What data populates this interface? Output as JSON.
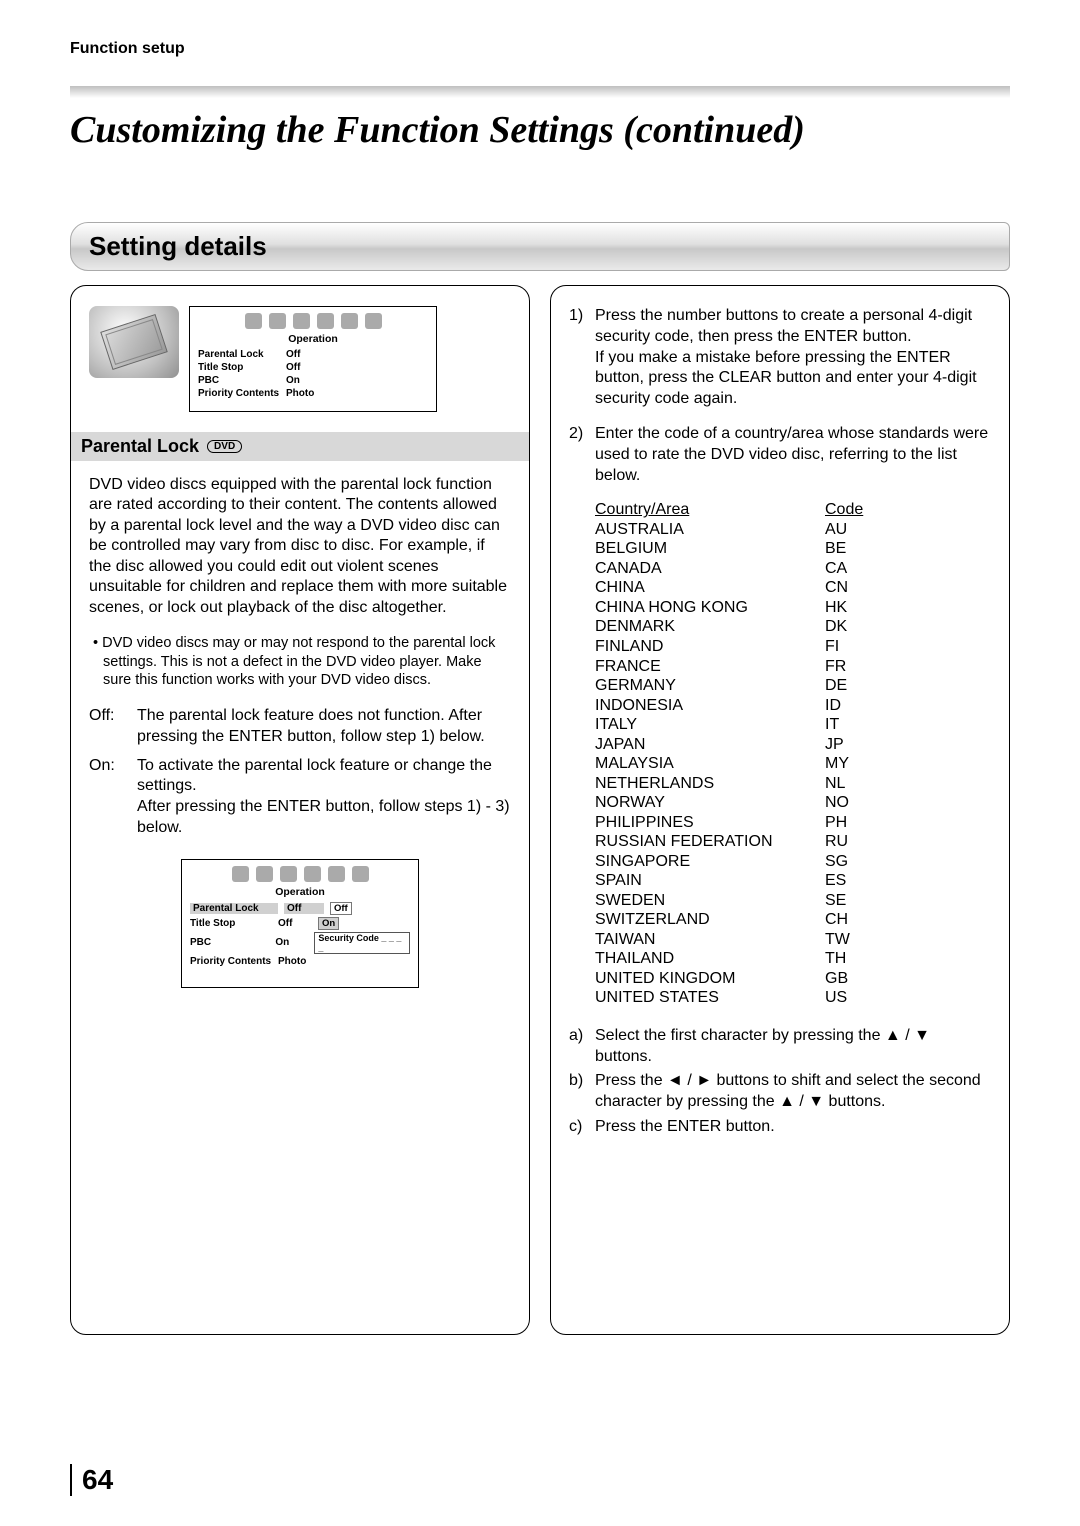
{
  "breadcrumb": "Function setup",
  "main_title": "Customizing the Function Settings (continued)",
  "section_header": "Setting details",
  "page_number": "64",
  "left": {
    "osd_title": "Operation",
    "rows": [
      {
        "label": "Parental Lock",
        "val": "Off"
      },
      {
        "label": "Title Stop",
        "val": "Off"
      },
      {
        "label": "PBC",
        "val": "On"
      },
      {
        "label": "Priority Contents",
        "val": "Photo"
      }
    ],
    "sub_header": "Parental Lock",
    "dvd_badge": "DVD",
    "intro": "DVD video discs equipped with the parental lock function are rated according to their content. The contents allowed by a parental lock level and the way a DVD video disc can be controlled may vary from disc to disc. For example, if the disc allowed you could edit out violent scenes unsuitable for children and replace them with more suitable scenes, or lock out playback of the disc altogether.",
    "bullet": "• DVD video discs may or may not respond to the parental lock settings. This is not a defect in the DVD video player. Make sure this function works with your DVD video discs.",
    "off_label": "Off:",
    "off_text": "The parental lock feature does not function. After pressing the ENTER button, follow step 1) below.",
    "on_label": "On:",
    "on_text": "To activate the parental lock feature or change the settings.\nAfter pressing the ENTER button, follow steps 1) - 3) below.",
    "osd2_title": "Operation",
    "osd2_opts": {
      "off": "Off",
      "on": "On",
      "sc": "Security Code _ _ _ _"
    },
    "osd2_rows": [
      {
        "label": "Parental Lock",
        "val": "Off",
        "selected": true
      },
      {
        "label": "Title Stop",
        "val": "Off"
      },
      {
        "label": "PBC",
        "val": "On"
      },
      {
        "label": "Priority Contents",
        "val": "Photo"
      }
    ]
  },
  "right": {
    "step1_num": "1)",
    "step1": "Press the number buttons to create a personal 4-digit security code, then press the ENTER button.\nIf you make a mistake before pressing the ENTER button, press the CLEAR button and enter your 4-digit security code again.",
    "step2_num": "2)",
    "step2": "Enter the code of a country/area whose standards were used to rate the DVD video disc, referring to the list below.",
    "table_header_country": "Country/Area",
    "table_header_code": "Code",
    "countries": [
      {
        "name": "AUSTRALIA",
        "code": "AU"
      },
      {
        "name": "BELGIUM",
        "code": "BE"
      },
      {
        "name": "CANADA",
        "code": "CA"
      },
      {
        "name": "CHINA",
        "code": "CN"
      },
      {
        "name": "CHINA HONG KONG",
        "code": "HK"
      },
      {
        "name": "DENMARK",
        "code": "DK"
      },
      {
        "name": "FINLAND",
        "code": "FI"
      },
      {
        "name": "FRANCE",
        "code": "FR"
      },
      {
        "name": "GERMANY",
        "code": "DE"
      },
      {
        "name": "INDONESIA",
        "code": "ID"
      },
      {
        "name": "ITALY",
        "code": "IT"
      },
      {
        "name": "JAPAN",
        "code": "JP"
      },
      {
        "name": "MALAYSIA",
        "code": "MY"
      },
      {
        "name": "NETHERLANDS",
        "code": "NL"
      },
      {
        "name": "NORWAY",
        "code": "NO"
      },
      {
        "name": "PHILIPPINES",
        "code": "PH"
      },
      {
        "name": "RUSSIAN FEDERATION",
        "code": "RU"
      },
      {
        "name": "SINGAPORE",
        "code": "SG"
      },
      {
        "name": "SPAIN",
        "code": "ES"
      },
      {
        "name": "SWEDEN",
        "code": "SE"
      },
      {
        "name": "SWITZERLAND",
        "code": "CH"
      },
      {
        "name": "TAIWAN",
        "code": "TW"
      },
      {
        "name": "THAILAND",
        "code": "TH"
      },
      {
        "name": "UNITED KINGDOM",
        "code": "GB"
      },
      {
        "name": "UNITED STATES",
        "code": "US"
      }
    ],
    "sub_a_num": "a)",
    "sub_a": "Select the first character by pressing the ▲ / ▼ buttons.",
    "sub_b_num": "b)",
    "sub_b": "Press the ◄ / ► buttons to shift and select the second character by pressing the ▲ / ▼ buttons.",
    "sub_c_num": "c)",
    "sub_c": "Press the ENTER button."
  }
}
